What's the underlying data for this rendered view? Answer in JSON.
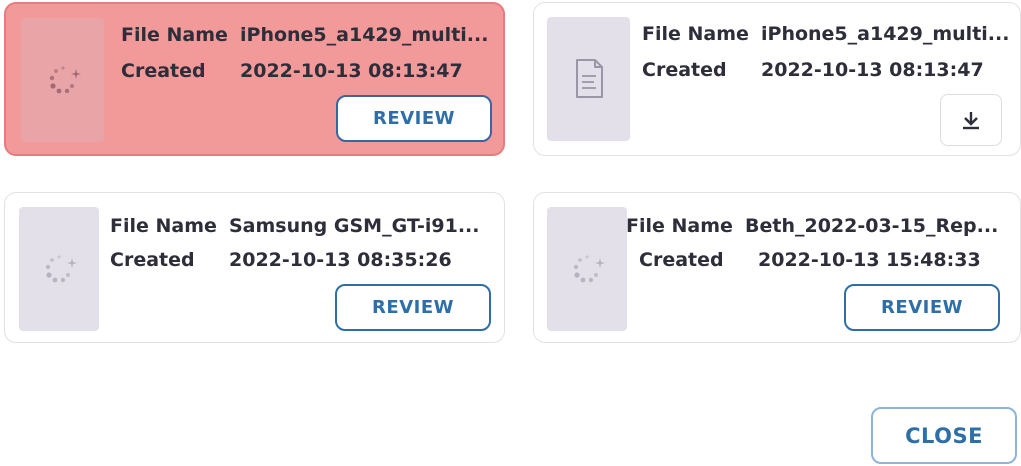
{
  "labels": {
    "file_name": "File Name",
    "created": "Created"
  },
  "cards": [
    {
      "file_name": "iPhone5_a1429_multi...",
      "created": "2022-10-13 08:13:47",
      "action_label": "REVIEW",
      "thumbnail": "loading-spinner-icon",
      "selected": true
    },
    {
      "file_name": "iPhone5_a1429_multi...",
      "created": "2022-10-13 08:13:47",
      "action": "download-icon",
      "thumbnail": "document-icon",
      "selected": false
    },
    {
      "file_name": "Samsung GSM_GT-i91...",
      "created": "2022-10-13 08:35:26",
      "action_label": "REVIEW",
      "thumbnail": "loading-spinner-icon",
      "selected": false
    },
    {
      "file_name": "Beth_2022-03-15_Rep...",
      "created": "2022-10-13 15:48:33",
      "action_label": "REVIEW",
      "thumbnail": "loading-spinner-icon",
      "selected": false
    }
  ],
  "close_label": "CLOSE",
  "colors": {
    "selected_card_bg": "#f2999a",
    "accent_blue": "#2f6fa8",
    "thumbnail_bg": "#e4e0ea"
  }
}
